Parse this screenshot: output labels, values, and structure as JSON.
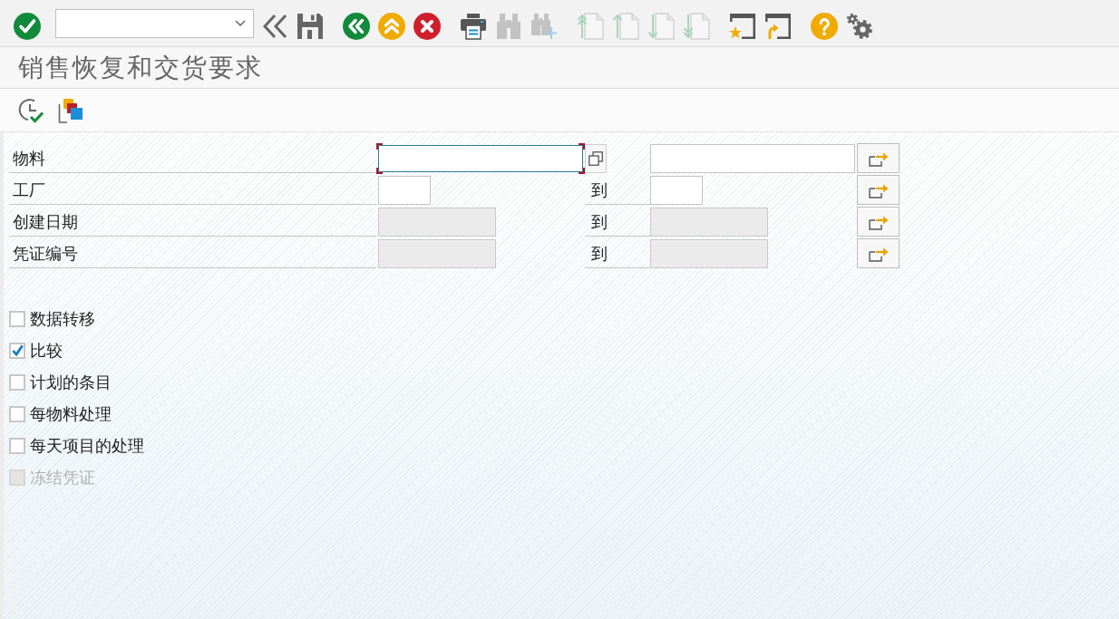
{
  "toolbar": {
    "items": [
      {
        "kind": "enter",
        "disabled": false
      },
      {
        "kind": "command-field",
        "disabled": false
      },
      {
        "kind": "collapse",
        "disabled": false
      },
      {
        "kind": "save",
        "disabled": false
      },
      {
        "kind": "back",
        "disabled": false
      },
      {
        "kind": "exit",
        "disabled": false
      },
      {
        "kind": "cancel",
        "disabled": false
      },
      {
        "kind": "print",
        "disabled": false
      },
      {
        "kind": "find",
        "disabled": true
      },
      {
        "kind": "find-next",
        "disabled": true
      },
      {
        "kind": "first-page",
        "disabled": true
      },
      {
        "kind": "previous-page",
        "disabled": true
      },
      {
        "kind": "next-page",
        "disabled": true
      },
      {
        "kind": "last-page",
        "disabled": true
      },
      {
        "kind": "new-session",
        "disabled": false
      },
      {
        "kind": "shortcut",
        "disabled": false
      },
      {
        "kind": "help",
        "disabled": false
      },
      {
        "kind": "settings",
        "disabled": false
      }
    ]
  },
  "title": "销售恢复和交货要求",
  "app_toolbar": {
    "items": [
      {
        "kind": "execute"
      },
      {
        "kind": "get-variant"
      }
    ]
  },
  "selection_fields": [
    {
      "label": "物料",
      "low": {
        "focused": true,
        "disabled": false
      },
      "high": {
        "focused": false,
        "disabled": false
      }
    },
    {
      "label": "工厂",
      "to_label": "到",
      "low": {
        "focused": false,
        "disabled": false
      },
      "high": {
        "focused": false,
        "disabled": false
      }
    },
    {
      "label": "创建日期",
      "to_label": "到",
      "low": {
        "focused": false,
        "disabled": true
      },
      "high": {
        "focused": false,
        "disabled": true
      }
    },
    {
      "label": "凭证编号",
      "to_label": "到",
      "low": {
        "focused": false,
        "disabled": true
      },
      "high": {
        "focused": false,
        "disabled": true
      }
    }
  ],
  "options": [
    {
      "label": "数据转移",
      "checked": false,
      "disabled": false
    },
    {
      "label": "比较",
      "checked": true,
      "disabled": false
    },
    {
      "label": "计划的条目",
      "checked": false,
      "disabled": false
    },
    {
      "label": "每物料处理",
      "checked": false,
      "disabled": false
    },
    {
      "label": "每天项目的处理",
      "checked": false,
      "disabled": false
    },
    {
      "label": "冻结凭证",
      "checked": false,
      "disabled": true
    }
  ]
}
